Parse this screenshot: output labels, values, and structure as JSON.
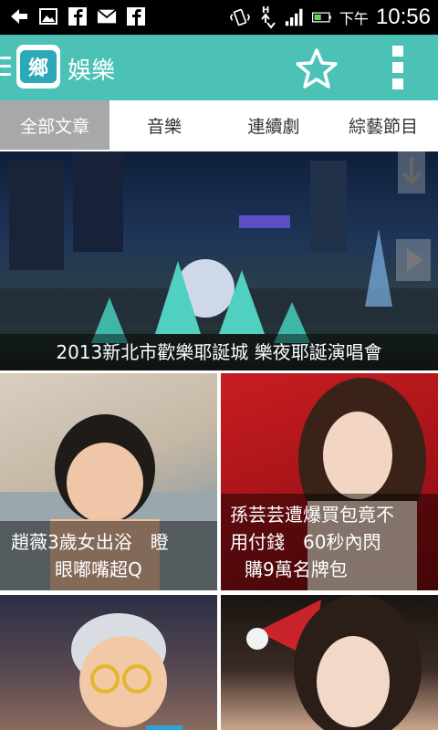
{
  "statusbar": {
    "ampm": "下午",
    "time": "10:56"
  },
  "appbar": {
    "logo_char": "鄉",
    "title": "娛樂"
  },
  "tabs": [
    {
      "label": "全部文章",
      "active": true
    },
    {
      "label": "音樂",
      "active": false
    },
    {
      "label": "連續劇",
      "active": false
    },
    {
      "label": "綜藝節目",
      "active": false
    }
  ],
  "articles": {
    "hero": {
      "caption": "2013新北市歡樂耶誕城 樂夜耶誕演唱會"
    },
    "tile1": {
      "caption_l1": "趙薇3歲女出浴　瞪",
      "caption_l2": "眼嘟嘴超Q"
    },
    "tile2": {
      "caption_l1": "孫芸芸遭爆買包竟不",
      "caption_l2": "用付錢　60秒內閃",
      "caption_l3": "購9萬名牌包"
    }
  },
  "colors": {
    "accent": "#4cc2b7",
    "tab_active": "#a8a8a8",
    "scroll_indicator": "#2aa3d6"
  },
  "icons": [
    "back-icon",
    "gallery-icon",
    "facebook-icon",
    "mail-icon",
    "facebook-icon",
    "vibrate-icon",
    "data-arrows-icon",
    "signal-icon",
    "battery-icon",
    "star-icon",
    "overflow-menu-icon",
    "download-icon",
    "play-icon"
  ]
}
